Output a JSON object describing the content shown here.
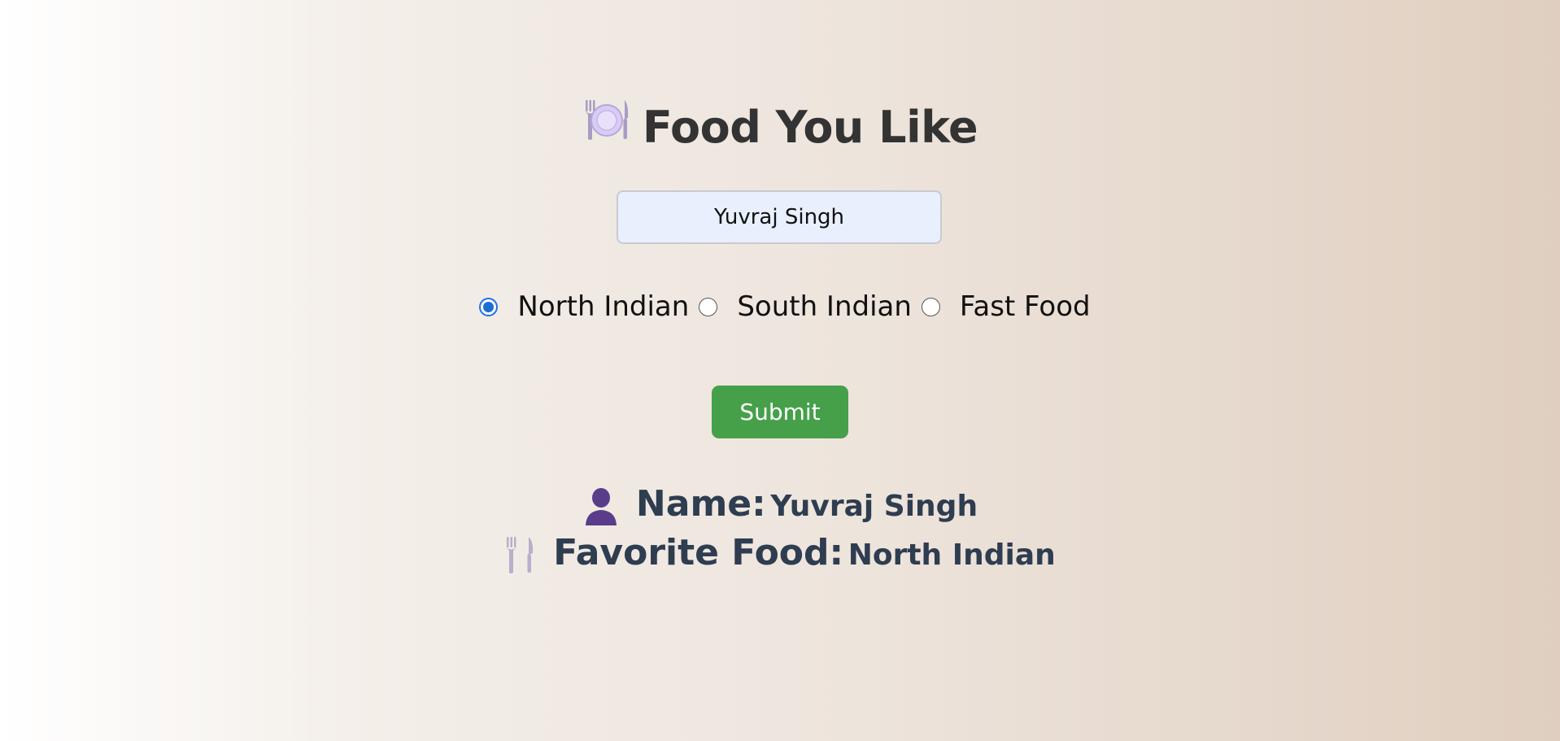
{
  "header": {
    "title": "Food You Like",
    "icon": "plate-fork-knife-icon"
  },
  "form": {
    "name_value": "Yuvraj Singh",
    "options": [
      {
        "label": "North Indian",
        "checked": true
      },
      {
        "label": "South Indian",
        "checked": false
      },
      {
        "label": "Fast Food",
        "checked": false
      }
    ],
    "submit_label": "Submit",
    "submit_color": "#45a049"
  },
  "result": {
    "name_label": "Name:",
    "name_value": "Yuvraj Singh",
    "name_icon": "person-icon",
    "food_label": "Favorite Food:",
    "food_value": "North Indian",
    "food_icon": "fork-knife-icon"
  },
  "colors": {
    "title": "#333333",
    "result_text": "#2e3d50",
    "radio_accent": "#1a6fd4"
  }
}
